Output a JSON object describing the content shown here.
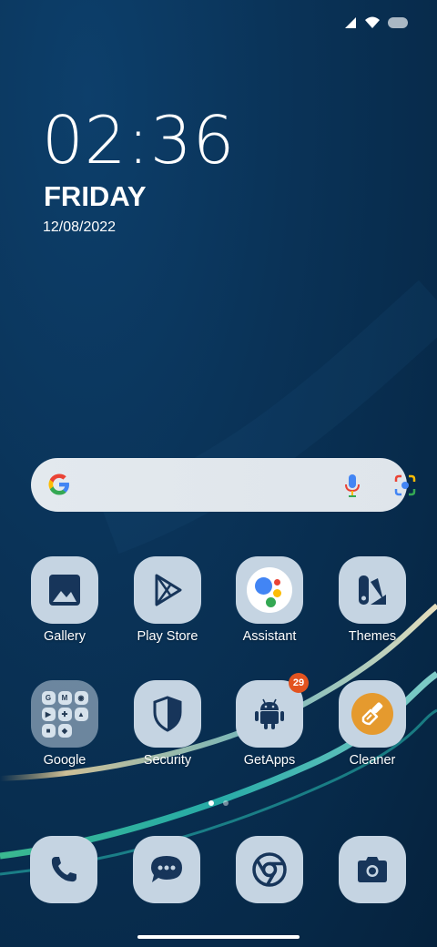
{
  "status_bar": {
    "icons": [
      "signal-icon",
      "wifi-icon",
      "battery-icon"
    ]
  },
  "lockscreen": {
    "time": "02:36",
    "day": "FRIDAY",
    "date": "12/08/2022"
  },
  "search_bar": {
    "icons": [
      "google-icon",
      "microphone-icon",
      "lens-icon"
    ]
  },
  "apps_row1": [
    {
      "label": "Gallery",
      "icon": "gallery-icon"
    },
    {
      "label": "Play Store",
      "icon": "play-store-icon"
    },
    {
      "label": "Assistant",
      "icon": "assistant-icon"
    },
    {
      "label": "Themes",
      "icon": "themes-icon"
    }
  ],
  "apps_row2": [
    {
      "label": "Google",
      "icon": "google-folder-icon"
    },
    {
      "label": "Security",
      "icon": "shield-icon"
    },
    {
      "label": "GetApps",
      "icon": "android-icon",
      "badge": "29"
    },
    {
      "label": "Cleaner",
      "icon": "brush-icon"
    }
  ],
  "dock": [
    {
      "icon": "phone-icon"
    },
    {
      "icon": "messages-icon"
    },
    {
      "icon": "chrome-icon"
    },
    {
      "icon": "camera-icon"
    }
  ],
  "page_indicator": {
    "pages": 2,
    "active": 1
  },
  "colors": {
    "wallpaper": "#0a3358",
    "tile": "#c5d4e2",
    "icon": "#17355a",
    "badge": "#e3531f",
    "cleaner": "#e59a2e"
  }
}
